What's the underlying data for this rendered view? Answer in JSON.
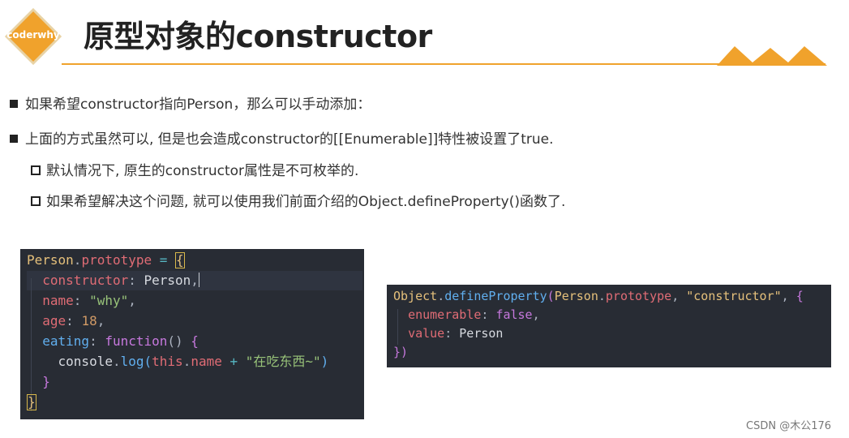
{
  "logo": {
    "text": "coderwhy"
  },
  "title": "原型对象的constructor",
  "bullets": [
    "如果希望constructor指向Person，那么可以手动添加：",
    "上面的方式虽然可以, 但是也会造成constructor的[[Enumerable]]特性被设置了true."
  ],
  "sub_bullets": [
    "默认情况下, 原生的constructor属性是不可枚举的.",
    "如果希望解决这个问题, 就可以使用我们前面介绍的Object.defineProperty()函数了."
  ],
  "code1": {
    "l1": {
      "obj": "Person",
      "dot": ".",
      "prop": "prototype",
      "eq": " = ",
      "brace": "{"
    },
    "l2": {
      "key": "constructor",
      "colon": ": ",
      "val": "Person",
      "comma": ","
    },
    "l3": {
      "key": "name",
      "colon": ": ",
      "val": "\"why\"",
      "comma": ","
    },
    "l4": {
      "key": "age",
      "colon": ": ",
      "val": "18",
      "comma": ","
    },
    "l5": {
      "key": "eating",
      "colon": ": ",
      "kw": "function",
      "paren": "()",
      "brace": " {"
    },
    "l6": {
      "obj": "console",
      "dot": ".",
      "fn": "log",
      "open": "(",
      "this": "this",
      "dot2": ".",
      "prop": "name",
      "plus": " + ",
      "str": "\"在吃东西~\"",
      "close": ")"
    },
    "l7": {
      "brace": "}"
    },
    "l8": {
      "brace": "}"
    }
  },
  "code2": {
    "l1": {
      "obj": "Object",
      "dot": ".",
      "fn": "defineProperty",
      "open": "(",
      "arg1": "Person",
      "dot2": ".",
      "arg1prop": "prototype",
      "comma": ", ",
      "str": "\"constructor\"",
      "comma2": ", ",
      "brace": "{"
    },
    "l2": {
      "key": "enumerable",
      "colon": ": ",
      "val": "false",
      "comma": ","
    },
    "l3": {
      "key": "value",
      "colon": ": ",
      "val": "Person"
    },
    "l4": {
      "brace": "}",
      "paren": ")"
    }
  },
  "watermark": "CSDN @木公176",
  "colors": {
    "accent": "#f0a22c",
    "code_bg": "#282c34"
  }
}
